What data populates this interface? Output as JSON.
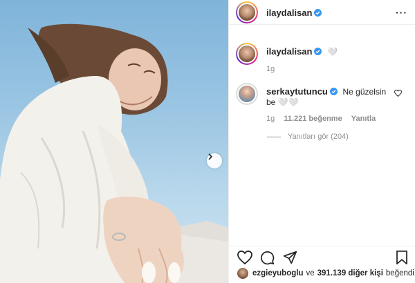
{
  "post": {
    "author": "ilaydalisan",
    "more_icon": "more-options-icon"
  },
  "caption": {
    "author": "ilaydalisan",
    "text": "🤍",
    "time": "1g"
  },
  "comments": [
    {
      "author": "serkaytutuncu",
      "text": "Ne güzelsin be 🤍🤍",
      "time": "1g",
      "likes": "11.221 beğenme",
      "reply_label": "Yanıtla",
      "view_replies": "Yanıtları gör (204)"
    }
  ],
  "actions": {
    "like_icon": "heart-icon",
    "comment_icon": "comment-icon",
    "share_icon": "share-icon",
    "save_icon": "bookmark-icon"
  },
  "likes_line": {
    "user": "ezgieyuboglu",
    "connector": "ve",
    "others": "391.139 diğer kişi",
    "suffix": "beğendi"
  },
  "colors": {
    "verified": "#3897f0",
    "text": "#262626",
    "muted": "#8e8e8e",
    "border": "#efefef"
  }
}
